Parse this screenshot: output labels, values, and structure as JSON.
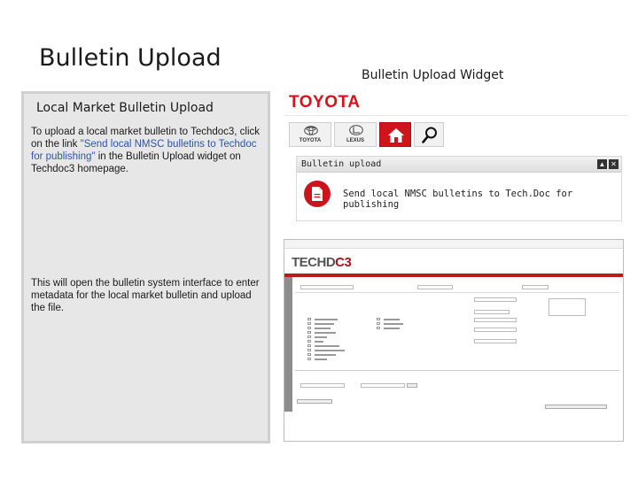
{
  "slide": {
    "title": "Bulletin Upload",
    "widget_title": "Bulletin Upload Widget"
  },
  "left_panel": {
    "heading": "Local Market Bulletin Upload",
    "paragraph_1_pre": "To upload a local market bulletin to Techdoc3, click on the link ",
    "paragraph_1_link": "\"Send local NMSC bulletins to Techdoc for publishing\"",
    "paragraph_1_post": " in the Bulletin Upload widget on Techdoc3 homepage.",
    "paragraph_2": "This will open the bulletin system interface to enter metadata for the local market bulletin and upload the file."
  },
  "toyota_shot": {
    "logo": "TOYOTA",
    "brand_toyota": "TOYOTA",
    "brand_lexus": "LEXUS",
    "widget_header": "Bulletin upload",
    "widget_link": "Send local NMSC bulletins to Tech.Doc for publishing",
    "minimize_glyph": "▲",
    "close_glyph": "✕"
  },
  "techdoc_shot": {
    "logo_prefix": "TECHD",
    "logo_suffix": "C3"
  },
  "colors": {
    "toyota_red": "#d7121a",
    "panel_bg": "#e7e7e7",
    "link_blue": "#2b55a8"
  }
}
